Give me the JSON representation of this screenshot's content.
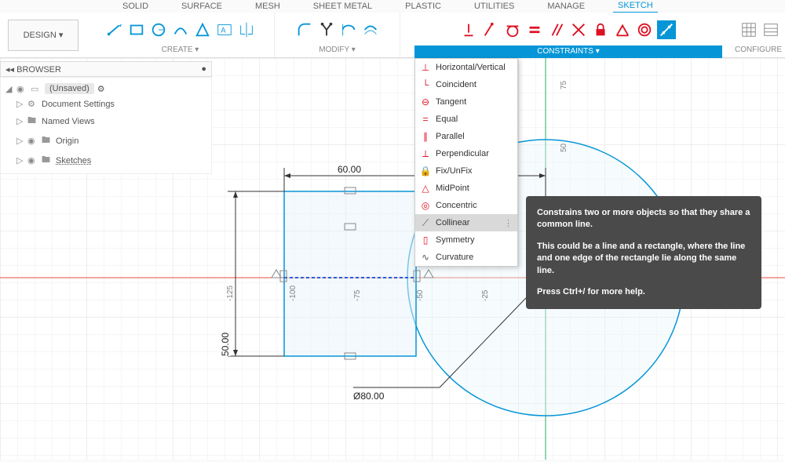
{
  "tabs": {
    "solid": "SOLID",
    "surface": "SURFACE",
    "mesh": "MESH",
    "sheet_metal": "SHEET METAL",
    "plastic": "PLASTIC",
    "utilities": "UTILITIES",
    "manage": "MANAGE",
    "sketch": "SKETCH"
  },
  "design_button": "DESIGN ▾",
  "toolbar_groups": {
    "create": "CREATE ▾",
    "modify": "MODIFY ▾",
    "constraints": "CONSTRAINTS ▾",
    "configure": "CONFIGURE"
  },
  "constraints_menu": {
    "horizontal_vertical": "Horizontal/Vertical",
    "coincident": "Coincident",
    "tangent": "Tangent",
    "equal": "Equal",
    "parallel": "Parallel",
    "perpendicular": "Perpendicular",
    "fix_unfix": "Fix/UnFix",
    "midpoint": "MidPoint",
    "concentric": "Concentric",
    "collinear": "Collinear",
    "symmetry": "Symmetry",
    "curvature": "Curvature"
  },
  "tooltip": {
    "line1": "Constrains two or more objects so that they share a common line.",
    "line2": "This could be a line and a rectangle, where the line and one edge of the rectangle lie along the same line.",
    "line3": "Press Ctrl+/ for more help."
  },
  "browser": {
    "title": "BROWSER",
    "unsaved": "(Unsaved)",
    "doc_settings": "Document Settings",
    "named_views": "Named Views",
    "origin": "Origin",
    "sketches": "Sketches"
  },
  "dimensions": {
    "width": "60.00",
    "height": "50.00",
    "diameter": "Ø80.00"
  },
  "axis": {
    "t75": "75",
    "t50": "50",
    "n125": "-125",
    "n100": "-100",
    "n75": "-75",
    "n50": "-50",
    "n25": "-25"
  }
}
